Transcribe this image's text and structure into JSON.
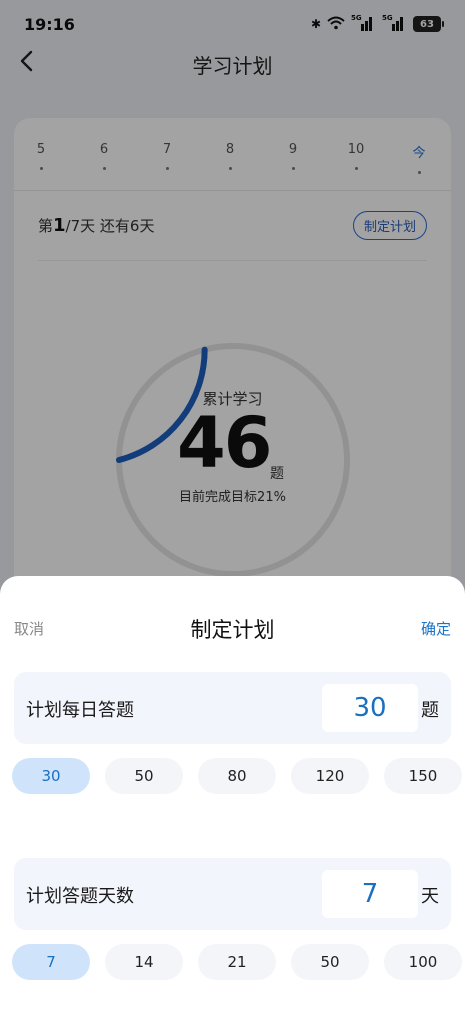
{
  "status_bar": {
    "time": "19:16",
    "network_label": "5G",
    "battery": "63"
  },
  "nav": {
    "title": "学习计划"
  },
  "plan_card": {
    "days": [
      "5",
      "6",
      "7",
      "8",
      "9",
      "10",
      "今"
    ],
    "progress_prefix": "第",
    "progress_current": "1",
    "progress_suffix": "/7天  还有6天",
    "make_plan_label": "制定计划",
    "ring_label": "累计学习",
    "ring_number": "46",
    "ring_unit": "题",
    "ring_sub": "目前完成目标21%",
    "progress_fraction": 0.21,
    "accent_color": "#1e5fc0"
  },
  "sheet": {
    "cancel_label": "取消",
    "title": "制定计划",
    "confirm_label": "确定",
    "daily": {
      "label": "计划每日答题",
      "value": "30",
      "unit": "题",
      "options": [
        "30",
        "50",
        "80",
        "120",
        "150"
      ],
      "selected": "30"
    },
    "days": {
      "label": "计划答题天数",
      "value": "7",
      "unit": "天",
      "options": [
        "7",
        "14",
        "21",
        "50",
        "100"
      ],
      "selected": "7"
    }
  }
}
